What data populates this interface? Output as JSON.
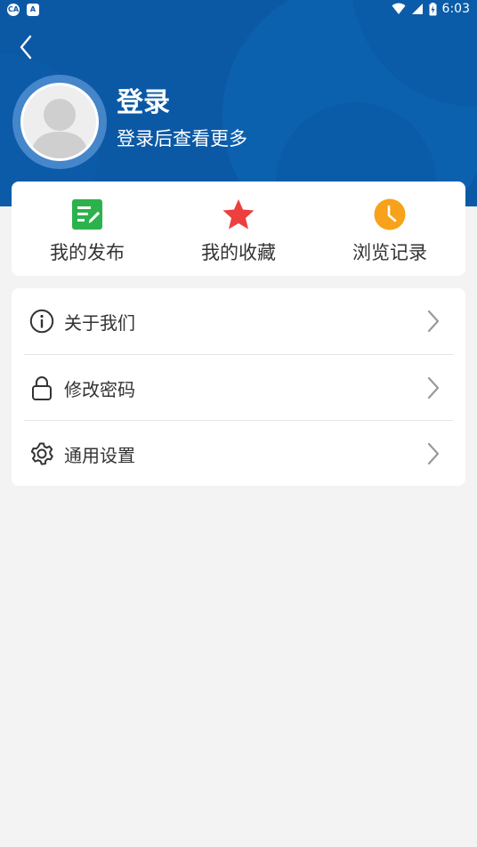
{
  "status_bar": {
    "left_icons": [
      "CA",
      "A"
    ],
    "time": "6:03"
  },
  "header": {
    "title": "登录",
    "subtitle": "登录后查看更多",
    "background_color": "#0b59a5"
  },
  "quick_actions": [
    {
      "label": "我的发布",
      "icon": "edit-icon",
      "color": "#2bb24c"
    },
    {
      "label": "我的收藏",
      "icon": "star-icon",
      "color": "#ee3f3f"
    },
    {
      "label": "浏览记录",
      "icon": "clock-icon",
      "color": "#f7a21a"
    }
  ],
  "menu": [
    {
      "label": "关于我们",
      "icon": "info-icon"
    },
    {
      "label": "修改密码",
      "icon": "lock-icon"
    },
    {
      "label": "通用设置",
      "icon": "gear-icon"
    }
  ]
}
